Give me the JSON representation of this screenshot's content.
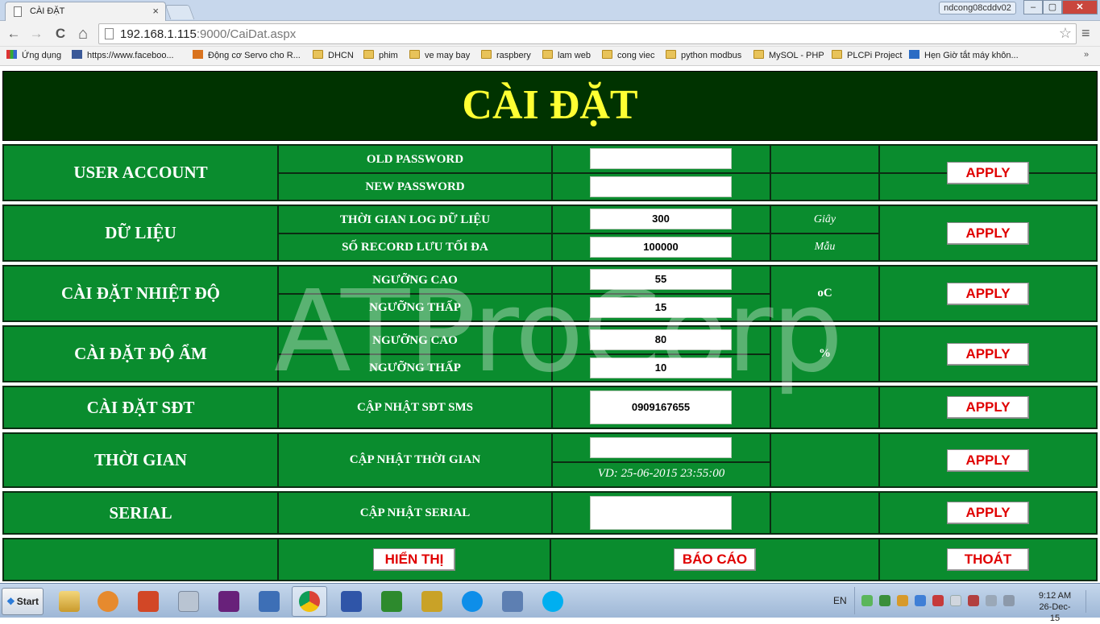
{
  "browser": {
    "tab_title": "CÀI ĐẶT",
    "tab_close": "×",
    "user": "ndcong08cddv02",
    "url_host": "192.168.1.115",
    "url_rest": ":9000/CaiDat.aspx",
    "back": "←",
    "forward": "→",
    "reload": "C",
    "home": "⌂",
    "star": "☆",
    "menu": "≡",
    "bookmarks": [
      "Ứng dụng",
      "https://www.faceboo...",
      "Động cơ Servo cho R...",
      "DHCN",
      "phim",
      "ve may bay",
      "raspbery",
      "lam web",
      "cong viec",
      "python modbus",
      "MySOL - PHP",
      "PLCPi Project",
      "Hẹn Giờ tắt máy khôn..."
    ],
    "bookmarks_more": "»"
  },
  "page": {
    "title": "CÀI ĐẶT",
    "watermark": "ATProCorp",
    "apply_label": "APPLY",
    "sections": {
      "user": {
        "title": "USER ACCOUNT",
        "old_password_label": "OLD PASSWORD",
        "new_password_label": "NEW PASSWORD",
        "old_password_value": "",
        "new_password_value": ""
      },
      "data": {
        "title": "DỮ LIỆU",
        "log_time_label": "THỜI GIAN LOG DỮ LIỆU",
        "log_time_value": "300",
        "log_time_unit": "Giây",
        "max_record_label": "SỐ RECORD LƯU TỐI ĐA",
        "max_record_value": "100000",
        "max_record_unit": "Mẫu"
      },
      "temp": {
        "title": "CÀI ĐẶT NHIỆT ĐỘ",
        "high_label": "NGƯỠNG CAO",
        "high_value": "55",
        "low_label": "NGƯỠNG THẤP",
        "low_value": "15",
        "unit": "oC"
      },
      "humidity": {
        "title": "CÀI ĐẶT ĐỘ ẨM",
        "high_label": "NGƯỠNG CAO",
        "high_value": "80",
        "low_label": "NGƯỠNG THẤP",
        "low_value": "10",
        "unit": "%"
      },
      "phone": {
        "title": "CÀI ĐẶT SĐT",
        "label": "CẬP NHẬT SĐT SMS",
        "value": "0909167655"
      },
      "time": {
        "title": "THỜI GIAN",
        "label": "CẬP NHẬT THỜI GIAN",
        "value": "",
        "example": "VD: 25-06-2015 23:55:00"
      },
      "serial": {
        "title": "SERIAL",
        "label": "CẬP NHẬT SERIAL",
        "value": ""
      }
    },
    "footer": {
      "show_button": "HIỂN THỊ",
      "report_button": "BÁO CÁO",
      "exit_button": "THOÁT"
    }
  },
  "taskbar": {
    "start_label": "Start",
    "start_logo": "❖",
    "lang": "EN",
    "time": "9:12 AM",
    "date": "26-Dec-15"
  }
}
